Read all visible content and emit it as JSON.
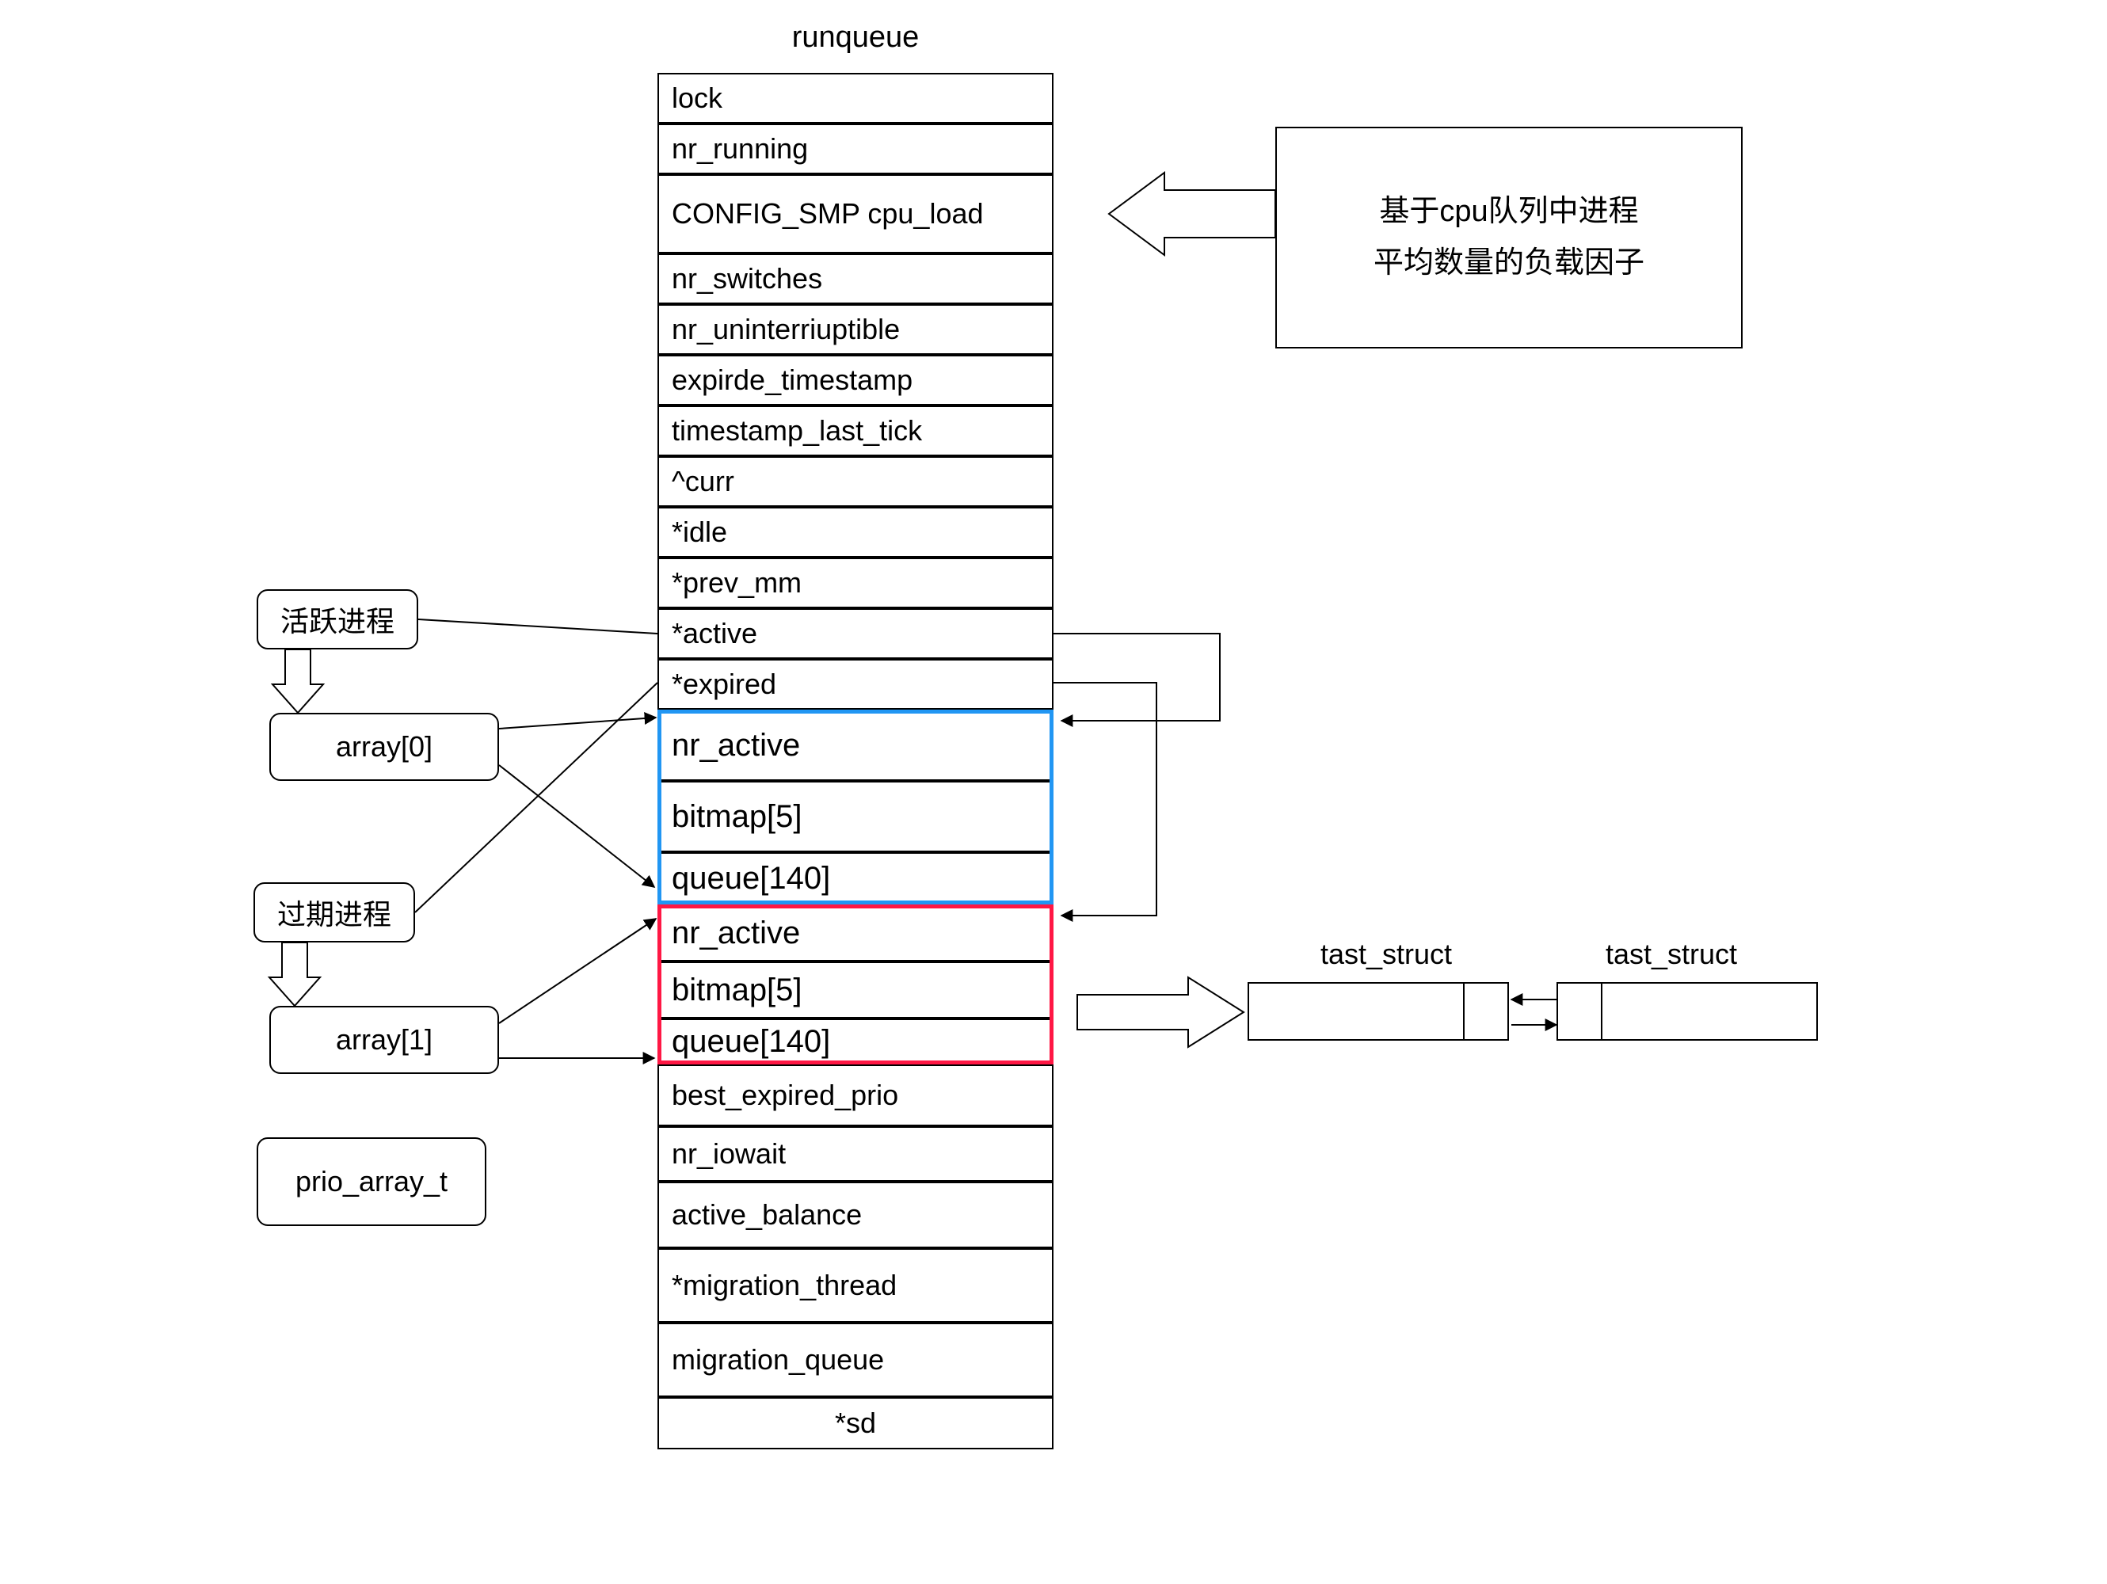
{
  "title": "runqueue",
  "runqueue_fields": [
    "lock",
    "nr_running",
    "CONFIG_SMP  cpu_load",
    "nr_switches",
    "nr_uninterriuptible",
    "expirde_timestamp",
    "timestamp_last_tick",
    "^curr",
    "*idle",
    "*prev_mm",
    "*active",
    "*expired"
  ],
  "array0": [
    "nr_active",
    "bitmap[5]",
    "queue[140]"
  ],
  "array1": [
    "nr_active",
    "bitmap[5]",
    "queue[140]"
  ],
  "runqueue_tail": [
    "best_expired_prio",
    "nr_iowait",
    "active_balance",
    "*migration_thread",
    "migration_queue",
    "*sd"
  ],
  "labels": {
    "active_proc": "活跃进程",
    "expired_proc": "过期进程",
    "array0": "array[0]",
    "array1": "array[1]",
    "prio_array_t": "prio_array_t",
    "task_struct_a": "tast_struct",
    "task_struct_b": "tast_struct"
  },
  "note": {
    "line1": "基于cpu队列中进程",
    "line2": "平均数量的负载因子"
  },
  "colors": {
    "blue": "#2196f3",
    "red": "#ff1744"
  }
}
